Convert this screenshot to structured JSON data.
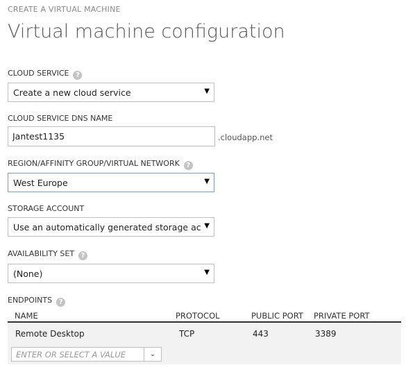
{
  "breadcrumb": "CREATE A VIRTUAL MACHINE",
  "title": "Virtual machine configuration",
  "icons": {
    "help": "help-question-icon",
    "dropdown": "triangle-down-icon",
    "combo": "chevron-down-icon"
  },
  "colors": {
    "help_icon": "#c4c4c4",
    "focused_border": "#7a9fcf",
    "row_bg": "#f2f2f2"
  },
  "cloud_service": {
    "label": "CLOUD SERVICE",
    "help": "?",
    "value": "Create a new cloud service",
    "arrow": "▼"
  },
  "dns_name": {
    "label": "CLOUD SERVICE DNS NAME",
    "value": "Jantest1135",
    "suffix": ".cloudapp.net"
  },
  "region": {
    "label": "REGION/AFFINITY GROUP/VIRTUAL NETWORK",
    "help": "?",
    "value": "West Europe",
    "arrow": "▼"
  },
  "storage": {
    "label": "STORAGE ACCOUNT",
    "value": "Use an automatically generated storage account",
    "arrow": "▼"
  },
  "availability": {
    "label": "AVAILABILITY SET",
    "help": "?",
    "value": "(None)",
    "arrow": "▼"
  },
  "endpoints": {
    "label": "ENDPOINTS",
    "help": "?",
    "columns": [
      "NAME",
      "PROTOCOL",
      "PUBLIC PORT",
      "PRIVATE PORT"
    ],
    "rows": [
      {
        "name": "Remote Desktop",
        "protocol": "TCP",
        "public_port": "443",
        "private_port": "3389"
      }
    ],
    "add_placeholder": "ENTER OR SELECT A VALUE",
    "combo_arrow": "⌄"
  }
}
